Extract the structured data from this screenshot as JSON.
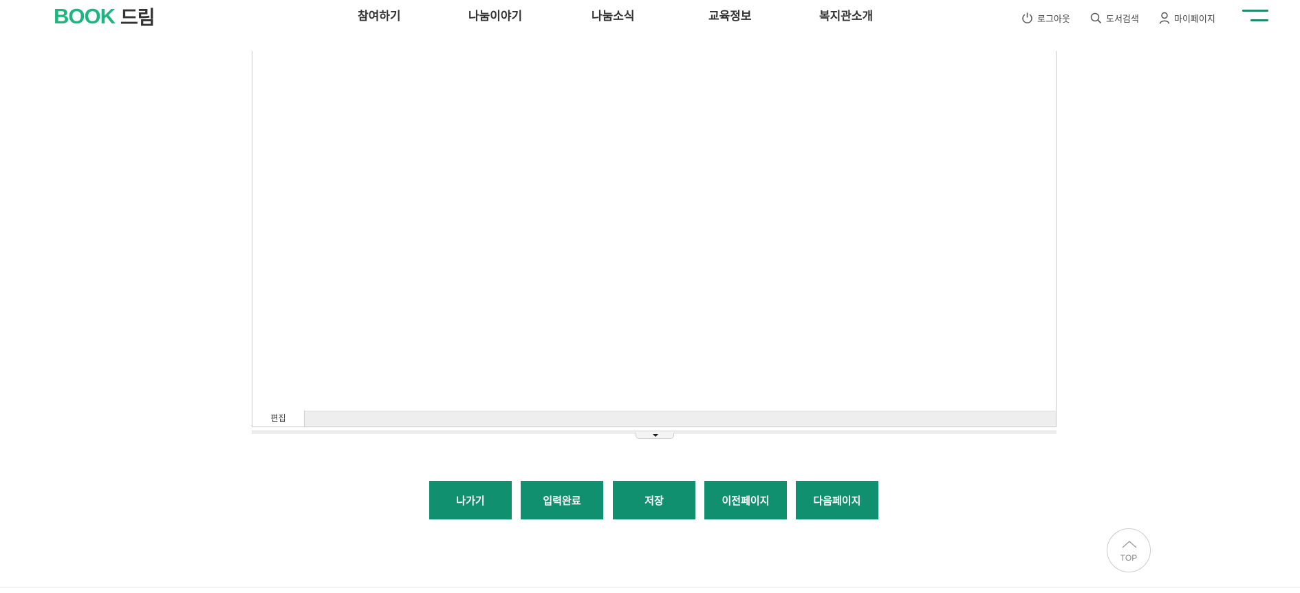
{
  "header": {
    "logo": {
      "en": "BOOK",
      "ko": "드림"
    },
    "nav": [
      "참여하기",
      "나눔이야기",
      "나눔소식",
      "교육정보",
      "복지관소개"
    ],
    "utils": {
      "logout": "로그아웃",
      "search": "도서검색",
      "mypage": "마이페이지"
    }
  },
  "editor": {
    "mode_tab": "편집"
  },
  "buttons": [
    "나가기",
    "입력완료",
    "저장",
    "이전페이지",
    "다음페이지"
  ],
  "top_button": {
    "label": "TOP"
  },
  "colors": {
    "brand": "#1fb57f",
    "button": "#11906f",
    "hamburger": "#1f8a6c"
  },
  "icons": [
    "power-icon",
    "search-icon",
    "user-icon",
    "hamburger-menu-icon",
    "chevron-up-icon",
    "caret-down-icon"
  ]
}
